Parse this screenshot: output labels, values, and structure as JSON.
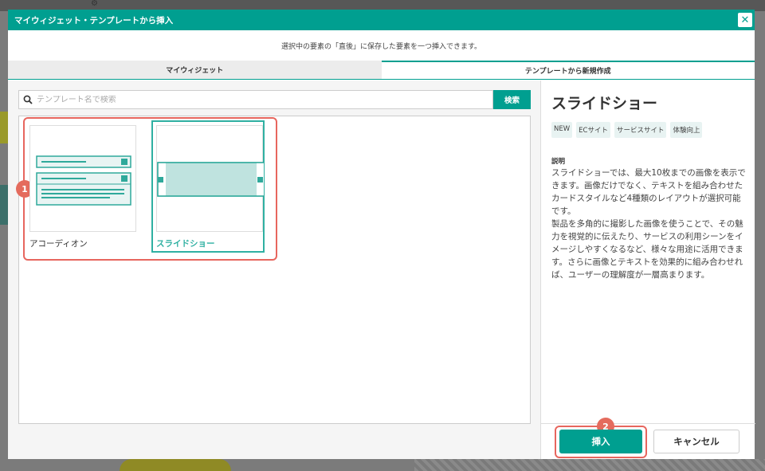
{
  "colors": {
    "accent": "#009f90",
    "highlight": "#e7665e",
    "badge": "#e46b5d"
  },
  "modal": {
    "title": "マイウィジェット・テンプレートから挿入",
    "close_icon": "close-icon",
    "subtitle": "選択中の要素の「直後」に保存した要素を一つ挿入できます。"
  },
  "tabs": [
    {
      "label": "マイウィジェット",
      "active": false
    },
    {
      "label": "テンプレートから新規作成",
      "active": true
    }
  ],
  "search": {
    "placeholder": "テンプレート名で検索",
    "button": "検索"
  },
  "templates": [
    {
      "name": "アコーディオン",
      "selected": false,
      "icon": "accordion-thumbnail"
    },
    {
      "name": "スライドショー",
      "selected": true,
      "icon": "slideshow-thumbnail"
    }
  ],
  "annotations": [
    "1",
    "2"
  ],
  "detail": {
    "title": "スライドショー",
    "tags": [
      "NEW",
      "ECサイト",
      "サービスサイト",
      "体験向上"
    ],
    "desc_label": "説明",
    "desc_p1": "スライドショーでは、最大10枚までの画像を表示できます。画像だけでなく、テキストを組み合わせたカードスタイルなど4種類のレイアウトが選択可能です。",
    "desc_p2": "製品を多角的に撮影した画像を使うことで、その魅力を視覚的に伝えたり、サービスの利用シーンをイメージしやすくなるなど、様々な用途に活用できます。さらに画像とテキストを効果的に組み合わせれば、ユーザーの理解度が一層高まります。"
  },
  "buttons": {
    "insert": "挿入",
    "cancel": "キャンセル"
  }
}
